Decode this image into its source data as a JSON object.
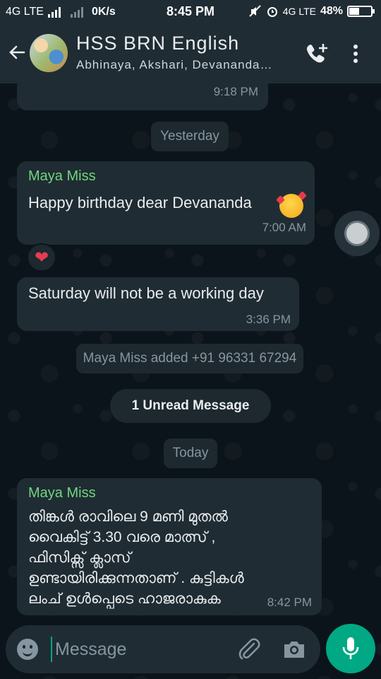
{
  "status_bar": {
    "network_left": "4G LTE",
    "data_speed": "0K/s",
    "time": "8:45 PM",
    "network_right": "4G LTE",
    "battery_percent": "48%",
    "battery_level": 0.48
  },
  "header": {
    "title": "HSS BRN English",
    "subtitle": "Abhinaya, Akshari, Devananda…",
    "icons": [
      "back-arrow-icon",
      "add-call-icon",
      "more-options-icon"
    ]
  },
  "messages": {
    "prev": {
      "time": "9:18 PM"
    },
    "date_yesterday": "Yesterday",
    "birthday": {
      "sender": "Maya Miss",
      "text": "Happy birthday dear Devananda",
      "time": "7:00 AM",
      "reaction": "❤"
    },
    "saturday": {
      "text": "Saturday will not be a working day",
      "time": "3:36 PM"
    },
    "system_added": "Maya Miss added +91 96331 67294",
    "unread": "1 Unread Message",
    "date_today": "Today",
    "malayalam": {
      "sender": "Maya Miss",
      "lines": [
        "തിങ്കൾ രാവിലെ 9 മണി മുതൽ",
        "വൈകിട്ട് 3.30 വരെ മാത്സ് ,",
        "ഫിസിക്സ് ക്ലാസ്",
        "ഉണ്ടായിരിക്കുന്നതാണ് . കുട്ടികൾ",
        "ലംച് ഉൾപ്പെടെ ഹാജരാകുക"
      ],
      "time": "8:42 PM"
    }
  },
  "composer": {
    "placeholder": "Message",
    "icons": [
      "emoji-icon",
      "attach-icon",
      "camera-icon",
      "mic-icon"
    ]
  },
  "colors": {
    "background": "#0b141a",
    "bar": "#1f2c34",
    "bubble": "#202c33",
    "sender_name": "#6fd67e",
    "accent": "#00a884",
    "muted_text": "#8696a0"
  }
}
